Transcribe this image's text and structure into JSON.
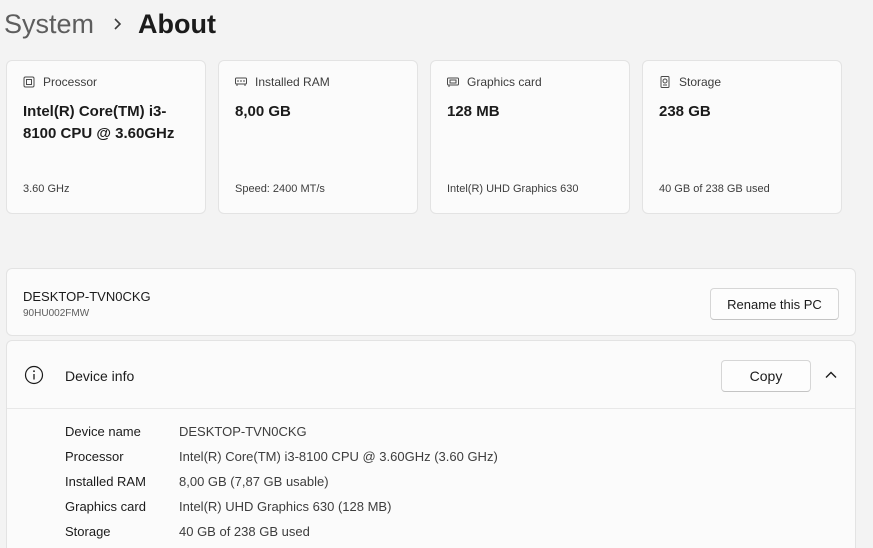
{
  "breadcrumb": {
    "parent": "System",
    "current": "About"
  },
  "specs": [
    {
      "icon": "processor-icon",
      "label": "Processor",
      "value": "Intel(R) Core(TM) i3-8100 CPU @ 3.60GHz",
      "sub": "3.60 GHz"
    },
    {
      "icon": "ram-icon",
      "label": "Installed RAM",
      "value": "8,00 GB",
      "sub": "Speed: 2400 MT/s"
    },
    {
      "icon": "graphics-card-icon",
      "label": "Graphics card",
      "value": "128 MB",
      "sub": "Intel(R) UHD Graphics 630"
    },
    {
      "icon": "storage-icon",
      "label": "Storage",
      "value": "238 GB",
      "sub": "40 GB of 238 GB used"
    }
  ],
  "pc": {
    "name": "DESKTOP-TVN0CKG",
    "model": "90HU002FMW",
    "rename_label": "Rename this PC"
  },
  "device_info": {
    "title": "Device info",
    "copy_label": "Copy",
    "rows": [
      {
        "label": "Device name",
        "value": "DESKTOP-TVN0CKG"
      },
      {
        "label": "Processor",
        "value": "Intel(R) Core(TM) i3-8100 CPU @ 3.60GHz (3.60 GHz)"
      },
      {
        "label": "Installed RAM",
        "value": "8,00 GB (7,87 GB usable)"
      },
      {
        "label": "Graphics card",
        "value": "Intel(R) UHD Graphics 630 (128 MB)"
      },
      {
        "label": "Storage",
        "value": "40 GB of 238 GB used"
      }
    ]
  }
}
